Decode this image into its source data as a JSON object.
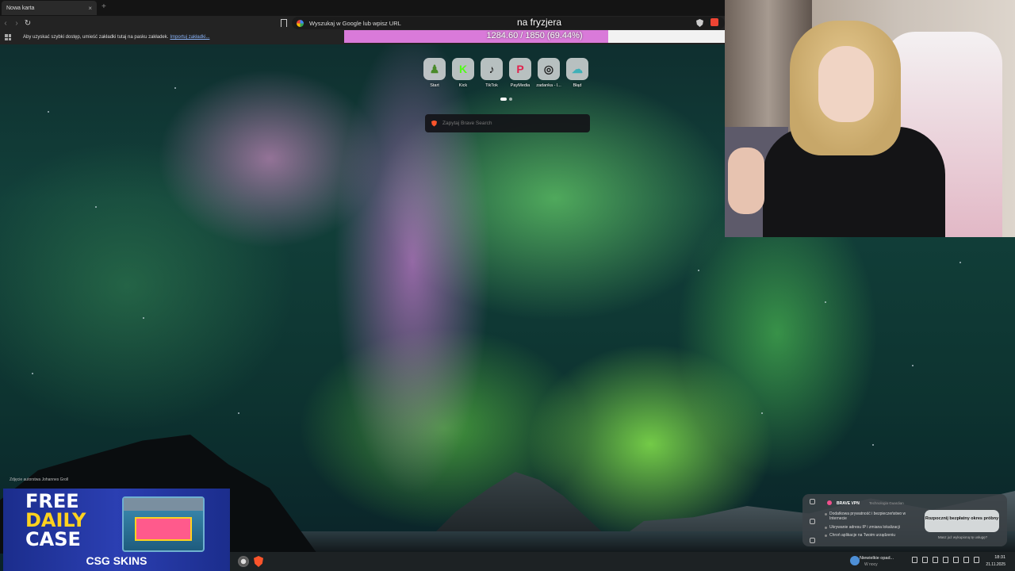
{
  "browser": {
    "tab": {
      "title": "Nowa karta",
      "close_glyph": "×"
    },
    "new_tab_glyph": "+",
    "nav": {
      "back_glyph": "‹",
      "forward_glyph": "›",
      "reload_glyph": "↻"
    },
    "omnibox": {
      "placeholder": "Wyszukaj w Google lub wpisz URL"
    },
    "bookmarks_bar": {
      "message": "Aby uzyskać szybki dostęp, umieść zakładki tutaj na pasku zakładek.",
      "import_link": "Importuj zakładki..."
    }
  },
  "stream_goal": {
    "title": "na fryzjera",
    "current": 1284.6,
    "target": 1850,
    "progress_fraction": 0.6944,
    "label": "1284.60 / 1850 (69.44%)",
    "fill_color": "#d97ad9"
  },
  "new_tab_page": {
    "shortcuts": [
      {
        "label": "Start",
        "icon": "chess-pawn-icon",
        "glyph": "♟",
        "color": "#4a8a2a"
      },
      {
        "label": "Kick",
        "icon": "kick-icon",
        "glyph": "K",
        "color": "#53fc18"
      },
      {
        "label": "TikTok",
        "icon": "tiktok-icon",
        "glyph": "♪",
        "color": "#111111"
      },
      {
        "label": "PayMedia",
        "icon": "paymedia-icon",
        "glyph": "P",
        "color": "#e0234e"
      },
      {
        "label": "zadanka - l...",
        "icon": "zadanka-icon",
        "glyph": "◎",
        "color": "#222222"
      },
      {
        "label": "Błąd",
        "icon": "error-page-icon",
        "glyph": "☁",
        "color": "#3fb0b8"
      }
    ],
    "search": {
      "placeholder": "Zapytaj Brave Search"
    },
    "photo_credit": "Zdjęcie autorstwa Johannes Groll"
  },
  "ad": {
    "line1": "FREE",
    "line2": "DAILY",
    "line3": "CASE",
    "brand": "CSG SKINS",
    "chest_label": "CSG SKINS"
  },
  "vpn_popup": {
    "title": "BRAVE VPN",
    "tech": "Technologia Guardian",
    "features": [
      "Dodatkowa prywatność i bezpieczeństwo w Internecie",
      "Ukrywanie adresu IP i zmiana lokalizacji",
      "Chroń aplikacje na Twoim urządzeniu"
    ],
    "trial_button": "Rozpocznij bezpłatny okres próbny",
    "already_link": "Masz już wykupioną tę usługę?"
  },
  "taskbar": {
    "weather_title": "Niewielkie opad...",
    "weather_sub": "W nocy",
    "time": "18:31",
    "date": "21.11.2025"
  }
}
